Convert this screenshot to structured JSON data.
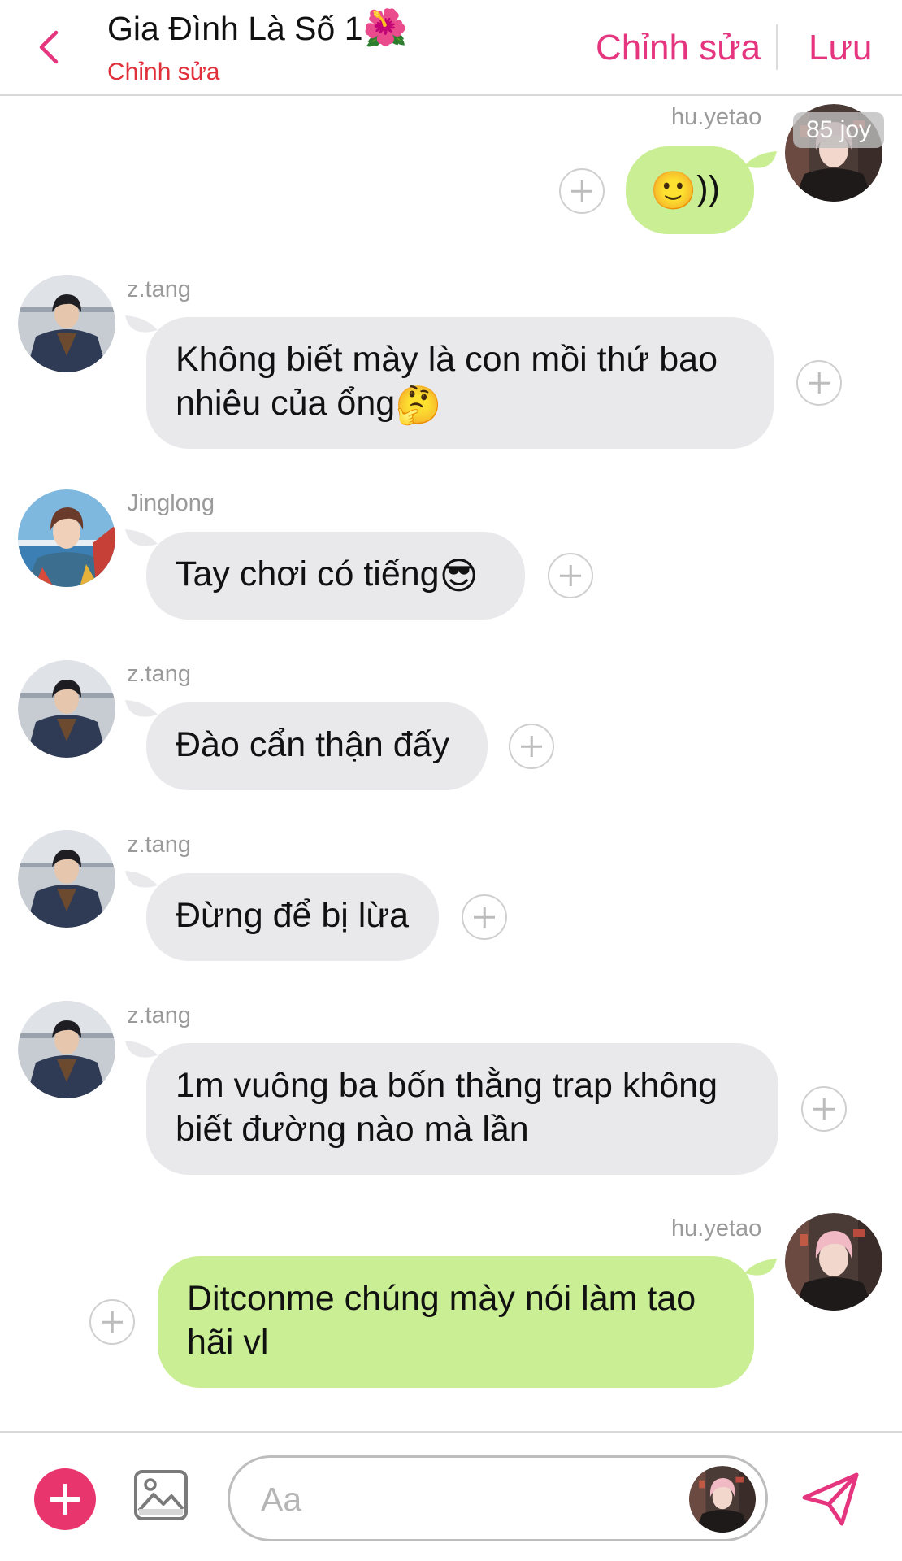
{
  "header": {
    "title": "Gia Đình Là Số 1",
    "title_emoji": "🌺",
    "subtitle": "Chỉnh sửa",
    "edit_label": "Chỉnh sửa",
    "save_label": "Lưu"
  },
  "overlay_badge": "85 joy",
  "messages": [
    {
      "sender": "hu.yetao",
      "side": "right",
      "color": "green",
      "text": "",
      "emoji": "🙂",
      "text_after": "))"
    },
    {
      "sender": "z.tang",
      "side": "left",
      "color": "gray",
      "text": "Không biết mày là con mồi thứ bao nhiêu của ổng",
      "emoji": "🤔"
    },
    {
      "sender": "Jinglong",
      "side": "left",
      "color": "gray",
      "text": "Tay chơi có tiếng",
      "emoji": "😎"
    },
    {
      "sender": "z.tang",
      "side": "left",
      "color": "gray",
      "text": "Đào cẩn thận đấy"
    },
    {
      "sender": "z.tang",
      "side": "left",
      "color": "gray",
      "text": "Đừng để bị lừa"
    },
    {
      "sender": "z.tang",
      "side": "left",
      "color": "gray",
      "text": "1m vuông ba bốn thằng trap không biết đường nào mà lần"
    },
    {
      "sender": "hu.yetao",
      "side": "right",
      "color": "green",
      "text": "Ditconme chúng mày nói làm tao hãi vl"
    }
  ],
  "composer": {
    "placeholder": "Aa"
  },
  "colors": {
    "accent": "#e6357f",
    "subtitle": "#e0303a",
    "bubble_gray": "#e9e9ec",
    "bubble_green": "#c9ee93",
    "plus_button": "#e8356e"
  },
  "icons": {
    "back": "chevron-left-icon",
    "react": "add-reaction-icon",
    "attach": "plus-icon",
    "image": "image-icon",
    "send": "send-icon"
  }
}
